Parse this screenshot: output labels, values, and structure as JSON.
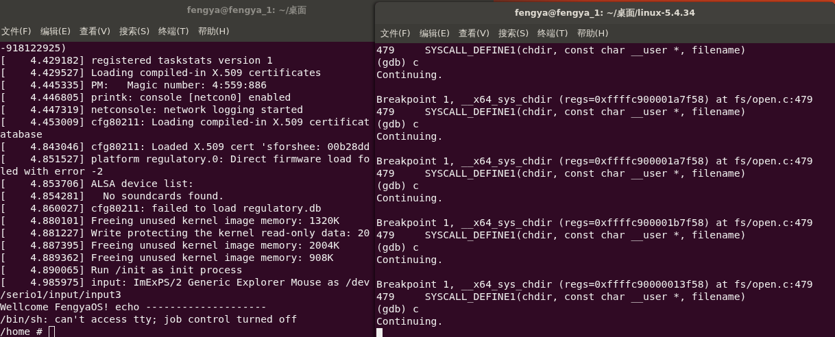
{
  "windows": [
    {
      "title": "fengya@fengya_1: ~/桌面",
      "focused": false,
      "menu": [
        {
          "label": "文件(F)"
        },
        {
          "label": "编辑(E)"
        },
        {
          "label": "查看(V)"
        },
        {
          "label": "搜索(S)"
        },
        {
          "label": "终端(T)"
        },
        {
          "label": "帮助(H)"
        }
      ],
      "blocks": [
        [
          "-918122925)",
          "[    4.429182] registered taskstats version 1",
          "[    4.429527] Loading compiled-in X.509 certificates",
          "[    4.445335] PM:   Magic number: 4:559:886",
          "[    4.446805] printk: console [netcon0] enabled",
          "[    4.447319] netconsole: network logging started",
          "[    4.453009] cfg80211: Loading compiled-in X.509 certificat",
          "atabase",
          "[    4.843046] cfg80211: Loaded X.509 cert 'sforshee: 00b28dd",
          "[    4.851527] platform regulatory.0: Direct firmware load fo",
          "led with error -2",
          "[    4.853706] ALSA device list:",
          "[    4.854281]   No soundcards found.",
          "[    4.860027] cfg80211: failed to load regulatory.db",
          "[    4.880101] Freeing unused kernel image memory: 1320K",
          "[    4.881227] Write protecting the kernel read-only data: 20",
          "[    4.887395] Freeing unused kernel image memory: 2004K",
          "[    4.889362] Freeing unused kernel image memory: 908K",
          "[    4.890065] Run /init as init process",
          "[    4.985975] input: ImExPS/2 Generic Explorer Mouse as /dev",
          "/serio1/input/input3",
          "Wellcome FengyaOS! echo --------------------",
          "/bin/sh: can't access tty; job control turned off",
          "/home # "
        ]
      ],
      "cursor_on_new_line": false
    },
    {
      "title": "fengya@fengya_1: ~/桌面/linux-5.4.34",
      "focused": true,
      "menu": [
        {
          "label": "文件(F)"
        },
        {
          "label": "编辑(E)"
        },
        {
          "label": "查看(V)"
        },
        {
          "label": "搜索(S)"
        },
        {
          "label": "终端(T)"
        },
        {
          "label": "帮助(H)"
        }
      ],
      "blocks": [
        [
          "479     SYSCALL_DEFINE1(chdir, const char __user *, filename)",
          "(gdb) c",
          "Continuing."
        ],
        [
          "Breakpoint 1, __x64_sys_chdir (regs=0xffffc900001a7f58) at fs/open.c:479",
          "479     SYSCALL_DEFINE1(chdir, const char __user *, filename)",
          "(gdb) c",
          "Continuing."
        ],
        [
          "Breakpoint 1, __x64_sys_chdir (regs=0xffffc900001a7f58) at fs/open.c:479",
          "479     SYSCALL_DEFINE1(chdir, const char __user *, filename)",
          "(gdb) c",
          "Continuing."
        ],
        [
          "Breakpoint 1, __x64_sys_chdir (regs=0xffffc900001b7f58) at fs/open.c:479",
          "479     SYSCALL_DEFINE1(chdir, const char __user *, filename)",
          "(gdb) c",
          "Continuing."
        ],
        [
          "Breakpoint 1, __x64_sys_chdir (regs=0xffffc90000013f58) at fs/open.c:479",
          "479     SYSCALL_DEFINE1(chdir, const char __user *, filename)",
          "(gdb) c",
          "Continuing."
        ]
      ],
      "cursor_on_new_line": true
    }
  ]
}
